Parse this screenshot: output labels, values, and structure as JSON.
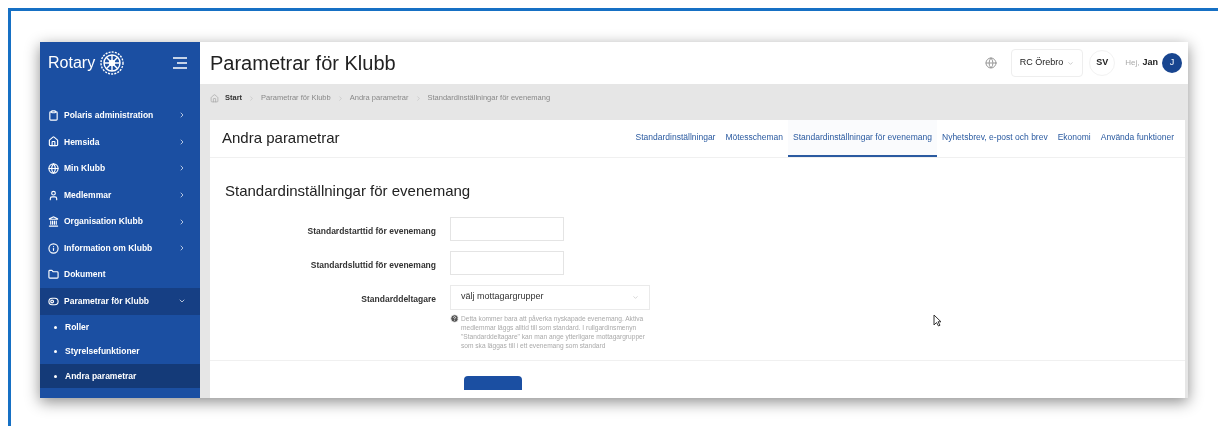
{
  "sidebar": {
    "logo": "Rotary",
    "items": [
      {
        "label": "Polaris administration",
        "kind": "menu",
        "expanded": false,
        "selected": false
      },
      {
        "label": "Hemsida",
        "kind": "menu",
        "expanded": false,
        "selected": false
      },
      {
        "label": "Min Klubb",
        "kind": "menu",
        "expanded": false,
        "selected": false
      },
      {
        "label": "Medlemmar",
        "kind": "menu",
        "expanded": false,
        "selected": false
      },
      {
        "label": "Organisation Klubb",
        "kind": "menu",
        "expanded": false,
        "selected": false
      },
      {
        "label": "Information om Klubb",
        "kind": "menu",
        "expanded": false,
        "selected": false
      },
      {
        "label": "Dokument",
        "kind": "link",
        "selected": false
      },
      {
        "label": "Parametrar för Klubb",
        "kind": "menu",
        "expanded": true,
        "selected": true,
        "children": [
          {
            "label": "Roller",
            "selected": false
          },
          {
            "label": "Styrelsefunktioner",
            "selected": false
          },
          {
            "label": "Andra parametrar",
            "selected": true
          }
        ]
      }
    ]
  },
  "header": {
    "title": "Parametrar för Klubb",
    "club_select": "RC Örebro",
    "language": "SV",
    "greeting": "Hej,",
    "user_name": "Jan",
    "avatar_initial": "J"
  },
  "breadcrumb": [
    "Start",
    "Parametrar för Klubb",
    "Andra parametrar",
    "Standardinställningar för evenemang"
  ],
  "card": {
    "title": "Andra parametrar",
    "tabs": [
      {
        "label": "Standardinställningar",
        "selected": false
      },
      {
        "label": "Mötesscheman",
        "selected": false
      },
      {
        "label": "Standardinställningar för evenemang",
        "selected": true
      },
      {
        "label": "Nyhetsbrev, e-post och brev",
        "selected": false
      },
      {
        "label": "Ekonomi",
        "selected": false
      },
      {
        "label": "Använda funktioner",
        "selected": false
      }
    ]
  },
  "section": {
    "title": "Standardinställningar för evenemang",
    "fields": [
      {
        "label": "Standardstarttid för evenemang",
        "kind": "text"
      },
      {
        "label": "Standardsluttid för evenemang",
        "kind": "text"
      },
      {
        "label": "Standarddeltagare",
        "kind": "select",
        "placeholder": "välj mottagargrupper",
        "help": "Detta kommer bara att påverka nyskapade evenemang. Aktiva medlemmar läggs alltid till som standard. I rullgardinsmenyn \"Standarddeltagare\" kan man ange ytterligare mottagargrupper som ska läggas till i ett evenemang som standard"
      }
    ]
  }
}
